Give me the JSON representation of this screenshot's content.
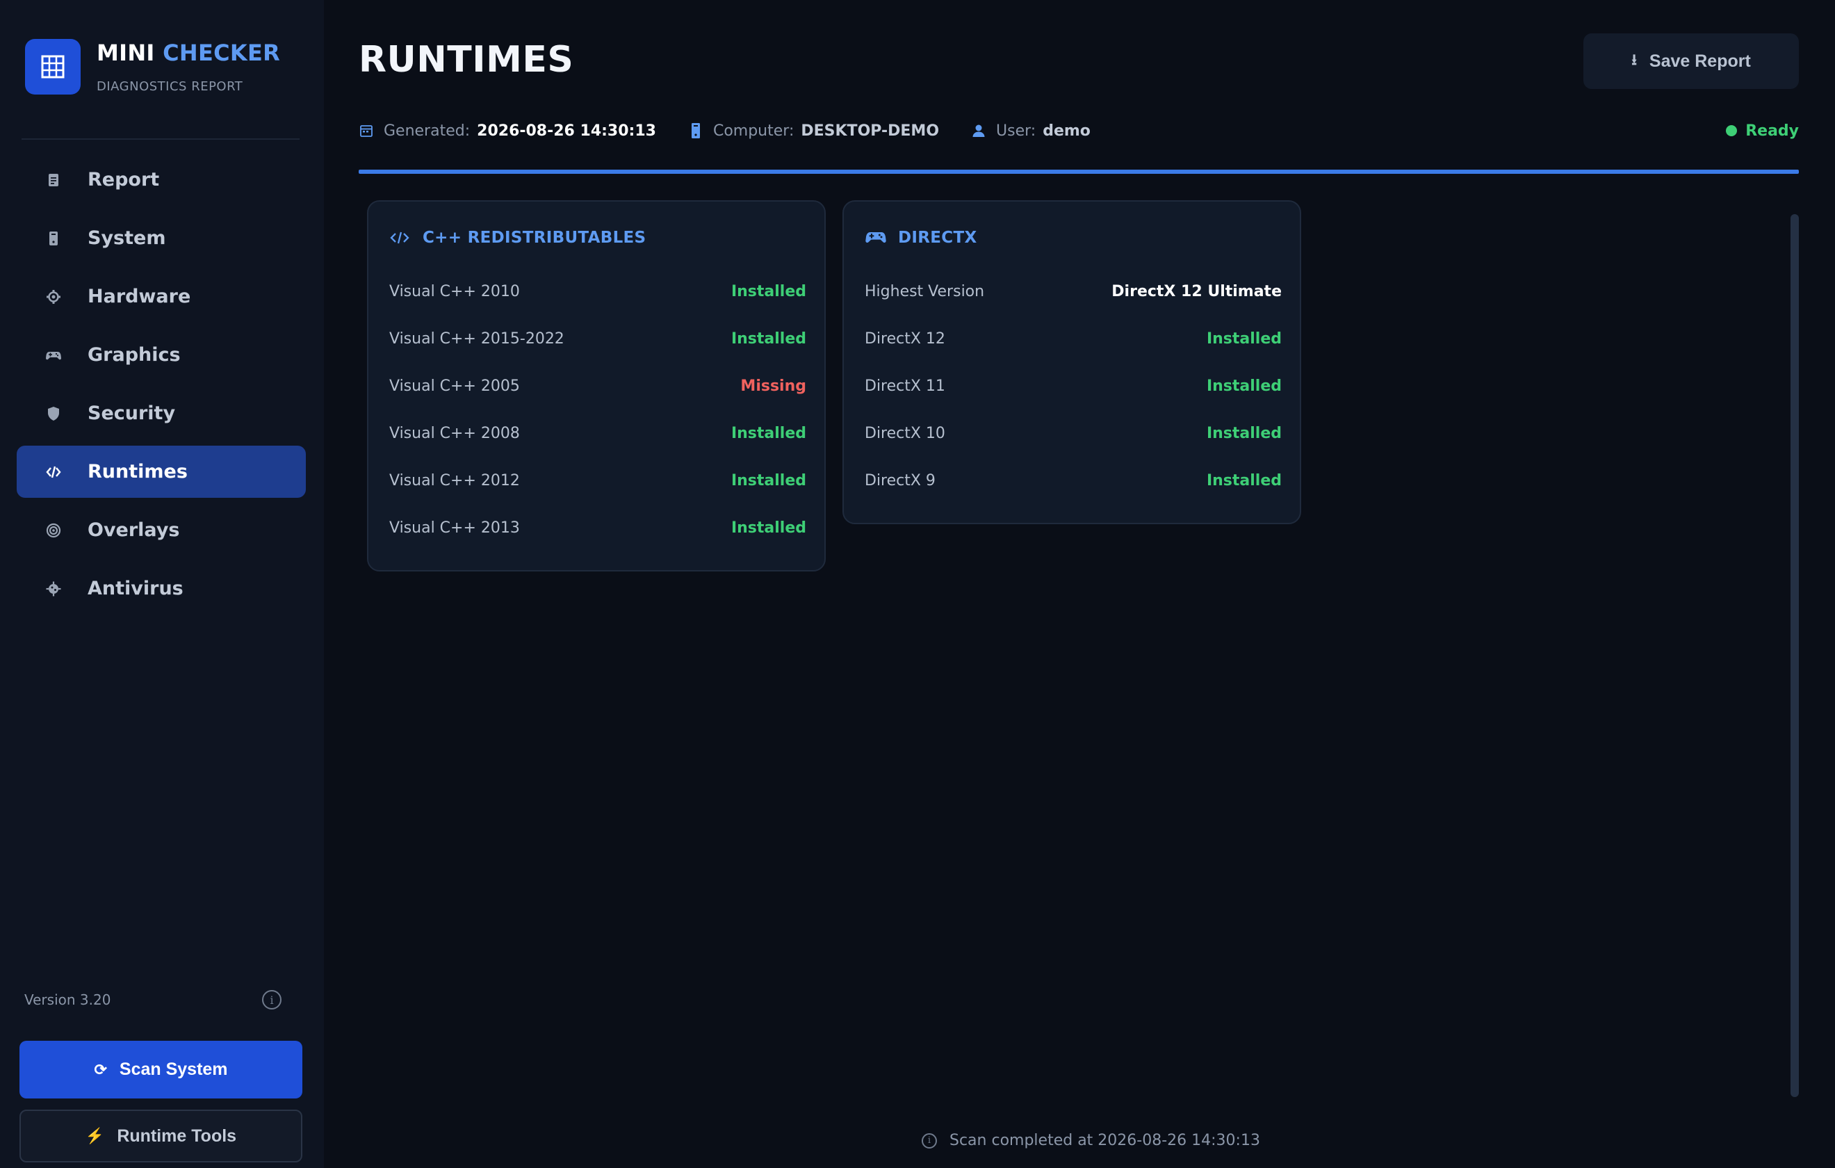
{
  "brand": {
    "title_word1": "MINI",
    "title_word2": "CHECKER",
    "subtitle": "DIAGNOSTICS REPORT",
    "logo_icon": "grid-icon"
  },
  "sidebar": {
    "items": [
      {
        "label": "Report",
        "icon": "document-icon",
        "active": false
      },
      {
        "label": "System",
        "icon": "tower-icon",
        "active": false
      },
      {
        "label": "Hardware",
        "icon": "gear-icon",
        "active": false
      },
      {
        "label": "Graphics",
        "icon": "gamepad-icon",
        "active": false
      },
      {
        "label": "Security",
        "icon": "shield-icon",
        "active": false
      },
      {
        "label": "Runtimes",
        "icon": "code-icon",
        "active": true
      },
      {
        "label": "Overlays",
        "icon": "target-icon",
        "active": false
      },
      {
        "label": "Antivirus",
        "icon": "virus-icon",
        "active": false
      }
    ],
    "version": "Version 3.20",
    "scan_label": "Scan System",
    "tools_label": "Runtime Tools"
  },
  "header": {
    "title": "RUNTIMES",
    "save_label": "Save Report",
    "generated_label": "Generated:",
    "generated_value": "2026-08-26 14:30:13",
    "computer_label": "Computer:",
    "computer_value": "DESKTOP-DEMO",
    "user_label": "User:",
    "user_value": "demo",
    "status": "Ready"
  },
  "cards": {
    "cpp": {
      "title": "C++ REDISTRIBUTABLES",
      "rows": [
        {
          "label": "Visual C++ 2010",
          "value": "Installed"
        },
        {
          "label": "Visual C++ 2015-2022",
          "value": "Installed"
        },
        {
          "label": "Visual C++ 2005",
          "value": "Missing"
        },
        {
          "label": "Visual C++ 2008",
          "value": "Installed"
        },
        {
          "label": "Visual C++ 2012",
          "value": "Installed"
        },
        {
          "label": "Visual C++ 2013",
          "value": "Installed"
        }
      ]
    },
    "directx": {
      "title": "DIRECTX",
      "rows": [
        {
          "label": "Highest Version",
          "value": "DirectX 12 Ultimate"
        },
        {
          "label": "DirectX 12",
          "value": "Installed"
        },
        {
          "label": "DirectX 11",
          "value": "Installed"
        },
        {
          "label": "DirectX 10",
          "value": "Installed"
        },
        {
          "label": "DirectX 9",
          "value": "Installed"
        }
      ]
    }
  },
  "footer": {
    "note": "Scan completed at 2026-08-26 14:30:13"
  },
  "colors": {
    "accent": "#3b7be8",
    "brand_blue": "#1f4fd8",
    "ok": "#3ecf76",
    "missing": "#f0625e"
  }
}
